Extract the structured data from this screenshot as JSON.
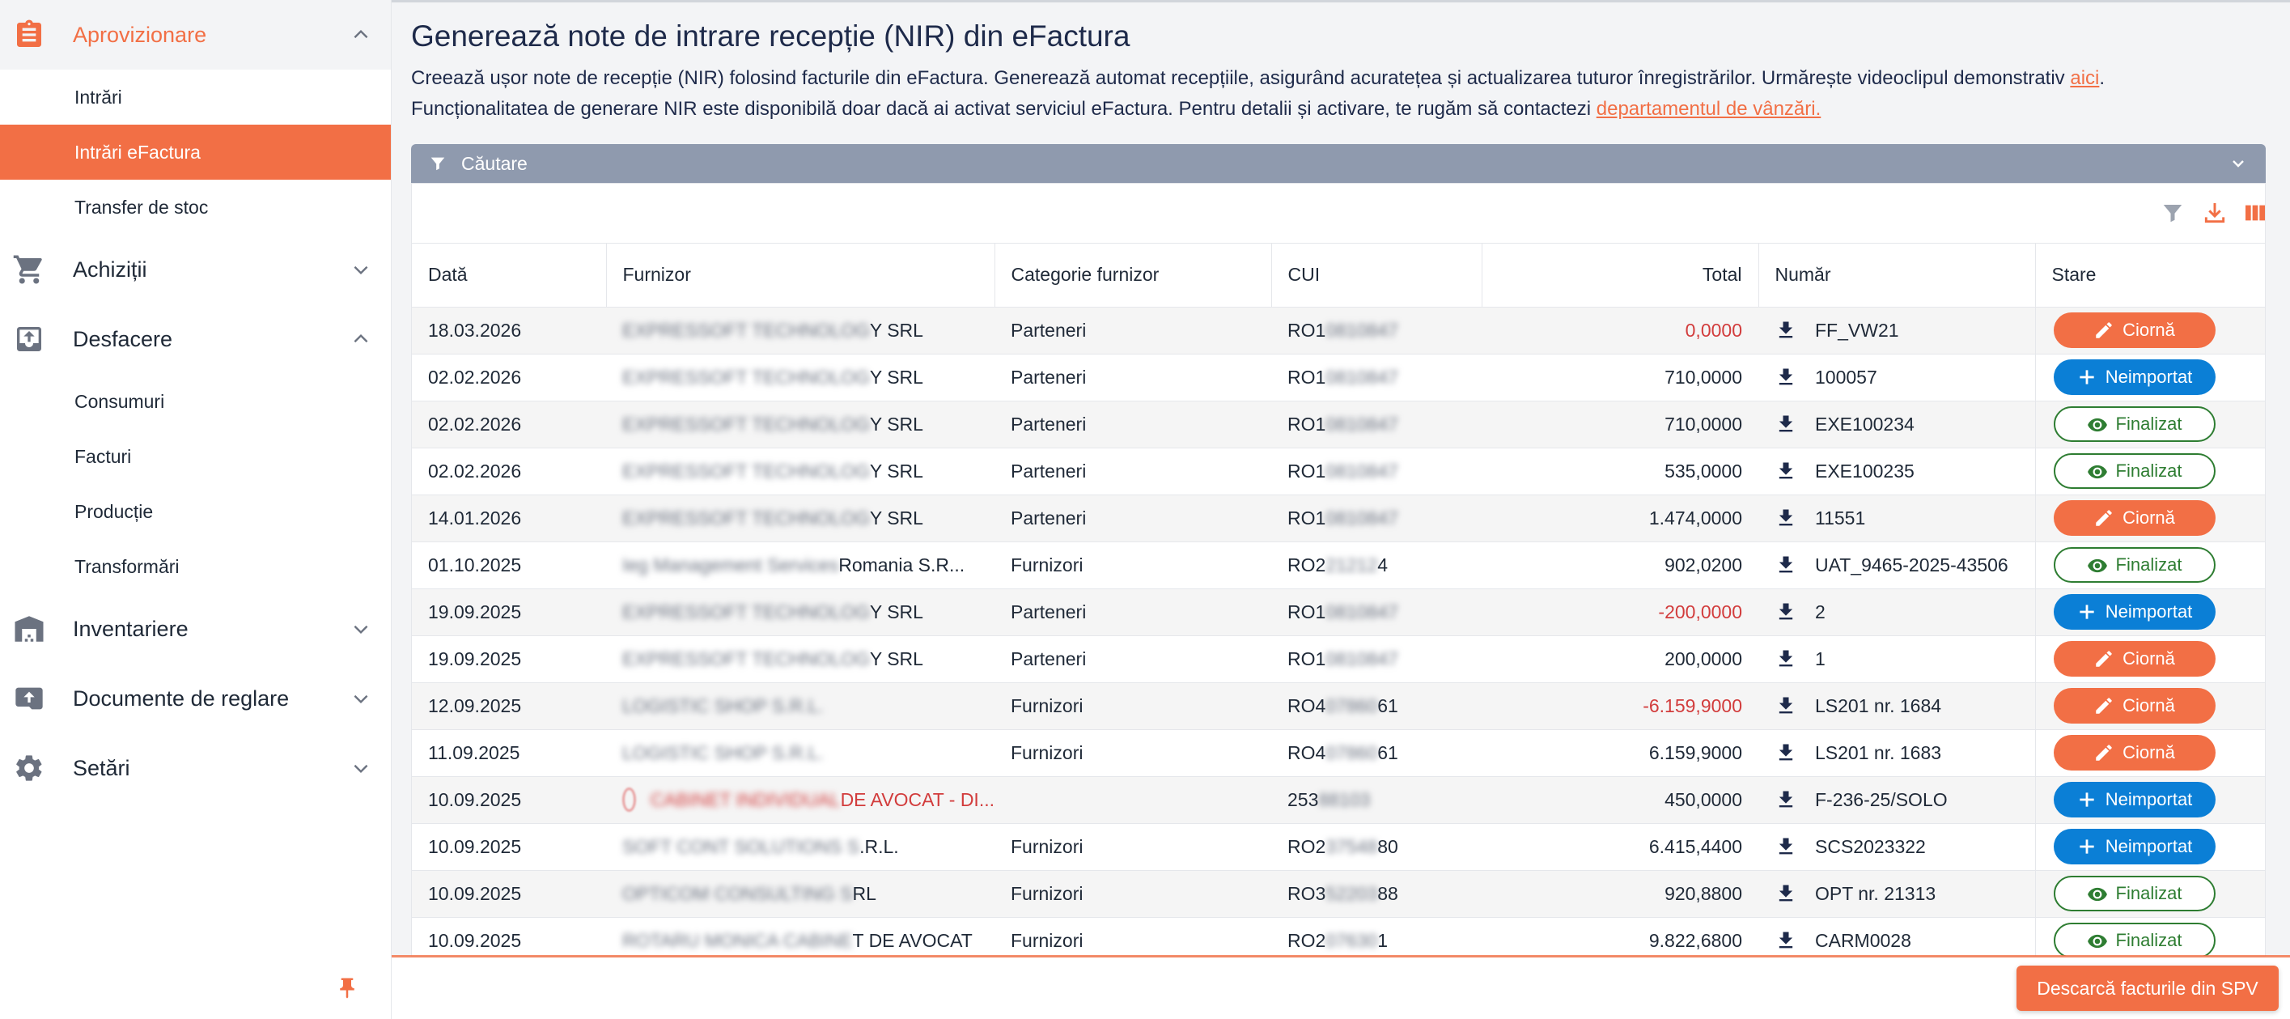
{
  "sidebar": {
    "groups": [
      {
        "label": "Aprovizionare",
        "icon": "clipboard-icon",
        "expanded": true,
        "active": true,
        "items": [
          {
            "label": "Intrări",
            "selected": false
          },
          {
            "label": "Intrări eFactura",
            "selected": true
          },
          {
            "label": "Transfer de stoc",
            "selected": false
          }
        ]
      },
      {
        "label": "Achiziții",
        "icon": "cart-icon",
        "expanded": false,
        "items": []
      },
      {
        "label": "Desfacere",
        "icon": "outbox-icon",
        "expanded": true,
        "items": [
          {
            "label": "Consumuri"
          },
          {
            "label": "Facturi"
          },
          {
            "label": "Producție"
          },
          {
            "label": "Transformări"
          }
        ]
      },
      {
        "label": "Inventariere",
        "icon": "warehouse-icon",
        "expanded": false,
        "items": []
      },
      {
        "label": "Documente de reglare",
        "icon": "archive-icon",
        "expanded": false,
        "items": []
      },
      {
        "label": "Setări",
        "icon": "gear-icon",
        "expanded": false,
        "items": []
      }
    ]
  },
  "header": {
    "title": "Generează note de intrare recepție (NIR) din eFactura",
    "desc_line1": "Creează ușor note de recepție (NIR) folosind facturile din eFactura. Generează automat recepțiile, asigurând acuratețea și actualizarea tuturor înregistrărilor. Urmărește videoclipul demonstrativ ",
    "desc_link1": "aici",
    "desc_line1_end": ".",
    "desc_line2": "Funcționalitatea de generare NIR este disponibilă doar dacă ai activat serviciul eFactura. Pentru detalii și activare, te rugăm să contactezi ",
    "desc_link2": "departamentul de vânzări."
  },
  "search": {
    "label": "Căutare"
  },
  "table": {
    "columns": {
      "date": "Dată",
      "supplier": "Furnizor",
      "category": "Categorie furnizor",
      "cui": "CUI",
      "total": "Total",
      "number": "Număr",
      "status": "Stare"
    },
    "rows": [
      {
        "date": "18.03.2026",
        "supplier_blur": "EXPRESSOFT TECHNOLOG",
        "supplier": "Y SRL",
        "category": "Parteneri",
        "cui": "RO1",
        "cui_blur": "0810847",
        "total": "0,0000",
        "negative": true,
        "number": "FF_VW21",
        "status": "Ciornă",
        "status_type": "ciorna"
      },
      {
        "date": "02.02.2026",
        "supplier_blur": "EXPRESSOFT TECHNOLOG",
        "supplier": "Y SRL",
        "category": "Parteneri",
        "cui": "RO1",
        "cui_blur": "0810847",
        "total": "710,0000",
        "negative": false,
        "number": "100057",
        "status": "Neimportat",
        "status_type": "neimportat"
      },
      {
        "date": "02.02.2026",
        "supplier_blur": "EXPRESSOFT TECHNOLOG",
        "supplier": "Y SRL",
        "category": "Parteneri",
        "cui": "RO1",
        "cui_blur": "0810847",
        "total": "710,0000",
        "negative": false,
        "number": "EXE100234",
        "status": "Finalizat",
        "status_type": "finalizat"
      },
      {
        "date": "02.02.2026",
        "supplier_blur": "EXPRESSOFT TECHNOLOG",
        "supplier": "Y SRL",
        "category": "Parteneri",
        "cui": "RO1",
        "cui_blur": "0810847",
        "total": "535,0000",
        "negative": false,
        "number": "EXE100235",
        "status": "Finalizat",
        "status_type": "finalizat"
      },
      {
        "date": "14.01.2026",
        "supplier_blur": "EXPRESSOFT TECHNOLOG",
        "supplier": "Y SRL",
        "category": "Parteneri",
        "cui": "RO1",
        "cui_blur": "0810847",
        "total": "1.474,0000",
        "negative": false,
        "number": "11551",
        "status": "Ciornă",
        "status_type": "ciorna"
      },
      {
        "date": "01.10.2025",
        "supplier_blur": "Ieg Management Services",
        "supplier": "Romania S.R...",
        "category": "Furnizori",
        "cui": "RO2",
        "cui_blur": "21212",
        "cui_tail": "4",
        "total": "902,0200",
        "negative": false,
        "number": "UAT_9465-2025-43506",
        "status": "Finalizat",
        "status_type": "finalizat"
      },
      {
        "date": "19.09.2025",
        "supplier_blur": "EXPRESSOFT TECHNOLOG",
        "supplier": "Y SRL",
        "category": "Parteneri",
        "cui": "RO1",
        "cui_blur": "0810847",
        "total": "-200,0000",
        "negative": true,
        "number": "2",
        "status": "Neimportat",
        "status_type": "neimportat"
      },
      {
        "date": "19.09.2025",
        "supplier_blur": "EXPRESSOFT TECHNOLOG",
        "supplier": "Y SRL",
        "category": "Parteneri",
        "cui": "RO1",
        "cui_blur": "0810847",
        "total": "200,0000",
        "negative": false,
        "number": "1",
        "status": "Ciornă",
        "status_type": "ciorna"
      },
      {
        "date": "12.09.2025",
        "supplier_blur": "LOGISTIC SHOP S.R.L.",
        "supplier": "",
        "category": "Furnizori",
        "cui": "RO4",
        "cui_blur": "07860",
        "cui_tail": "61",
        "total": "-6.159,9000",
        "negative": true,
        "number": "LS201 nr. 1684",
        "status": "Ciornă",
        "status_type": "ciorna"
      },
      {
        "date": "11.09.2025",
        "supplier_blur": "LOGISTIC SHOP S.R.L.",
        "supplier": "",
        "category": "Furnizori",
        "cui": "RO4",
        "cui_blur": "07860",
        "cui_tail": "61",
        "total": "6.159,9000",
        "negative": false,
        "number": "LS201 nr. 1683",
        "status": "Ciornă",
        "status_type": "ciorna"
      },
      {
        "date": "10.09.2025",
        "supplier_blur": "CABINET INDIVIDUAL",
        "supplier": "DE AVOCAT - DI...",
        "category": "",
        "cui": "253",
        "cui_blur": "88103",
        "total": "450,0000",
        "negative": false,
        "number": "F-236-25/SOLO",
        "status": "Neimportat",
        "status_type": "neimportat",
        "warning": true
      },
      {
        "date": "10.09.2025",
        "supplier_blur": "SOFT CONT SOLUTIONS S",
        "supplier": ".R.L.",
        "category": "Furnizori",
        "cui": "RO2",
        "cui_blur": "37548",
        "cui_tail": "80",
        "total": "6.415,4400",
        "negative": false,
        "number": "SCS2023322",
        "status": "Neimportat",
        "status_type": "neimportat"
      },
      {
        "date": "10.09.2025",
        "supplier_blur": "OPTICOM CONSULTING S",
        "supplier": "RL",
        "category": "Furnizori",
        "cui": "RO3",
        "cui_blur": "52203",
        "cui_tail": "88",
        "total": "920,8800",
        "negative": false,
        "number": "OPT nr. 21313",
        "status": "Finalizat",
        "status_type": "finalizat"
      },
      {
        "date": "10.09.2025",
        "supplier_blur": "ROTARU MONICA CABINE",
        "supplier": "T DE AVOCAT",
        "category": "Furnizori",
        "cui": "RO2",
        "cui_blur": "07630",
        "cui_tail": "1",
        "total": "9.822,6800",
        "negative": false,
        "number": "CARM0028",
        "status": "Finalizat",
        "status_type": "finalizat"
      }
    ]
  },
  "footer": {
    "download_spv_label": "Descarcă facturile din SPV"
  },
  "colors": {
    "accent": "#f26f45",
    "blue": "#0b7fd6",
    "green": "#2e7d32",
    "negative": "#d23c3c"
  }
}
